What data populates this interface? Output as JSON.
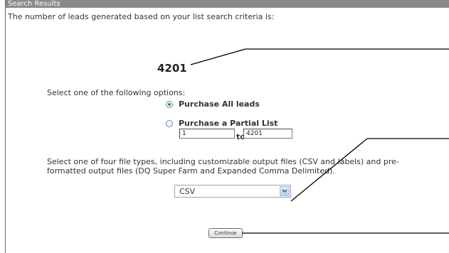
{
  "window": {
    "title": "Search Results"
  },
  "intro_text": "The number of leads generated based on your list search criteria is:",
  "lead_count": "4201",
  "options": {
    "prompt": "Select one of the following options:",
    "purchase_all_label": "Purchase All leads",
    "purchase_partial_label": "Purchase a Partial List",
    "range_from": "1",
    "range_to_label": "to",
    "range_to": "4201",
    "selected": "purchase_all"
  },
  "file_types": {
    "description": "Select one of four file types, including customizable output files (CSV and labels) and pre-formatted output files (DQ Super Farm and Expanded Comma Delimited).",
    "selected_value": "CSV"
  },
  "continue_label": "Continue",
  "colors": {
    "titlebar": "#8a8a8a",
    "radio_selected": "#2f9a2f",
    "select_border": "#8fa7c2"
  },
  "icons": {
    "dropdown": "chevron-down-icon"
  }
}
